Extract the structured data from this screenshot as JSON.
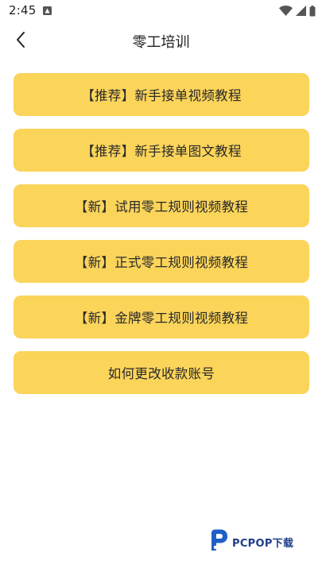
{
  "status_bar": {
    "time": "2:45",
    "icons": [
      "app-notification-icon",
      "wifi-icon",
      "signal-icon",
      "battery-icon"
    ]
  },
  "header": {
    "title": "零工培训",
    "back_icon": "chevron-left-icon"
  },
  "menu": {
    "items": [
      {
        "label": "【推荐】新手接单视频教程"
      },
      {
        "label": "【推荐】新手接单图文教程"
      },
      {
        "label": "【新】试用零工规则视频教程"
      },
      {
        "label": "【新】正式零工规则视频教程"
      },
      {
        "label": "【新】金牌零工规则视频教程"
      },
      {
        "label": "如何更改收款账号"
      }
    ]
  },
  "watermark": {
    "text": "PCPOP下载"
  },
  "colors": {
    "button_bg": "#fbd45a",
    "text": "#2a2a2a",
    "background": "#ffffff"
  }
}
